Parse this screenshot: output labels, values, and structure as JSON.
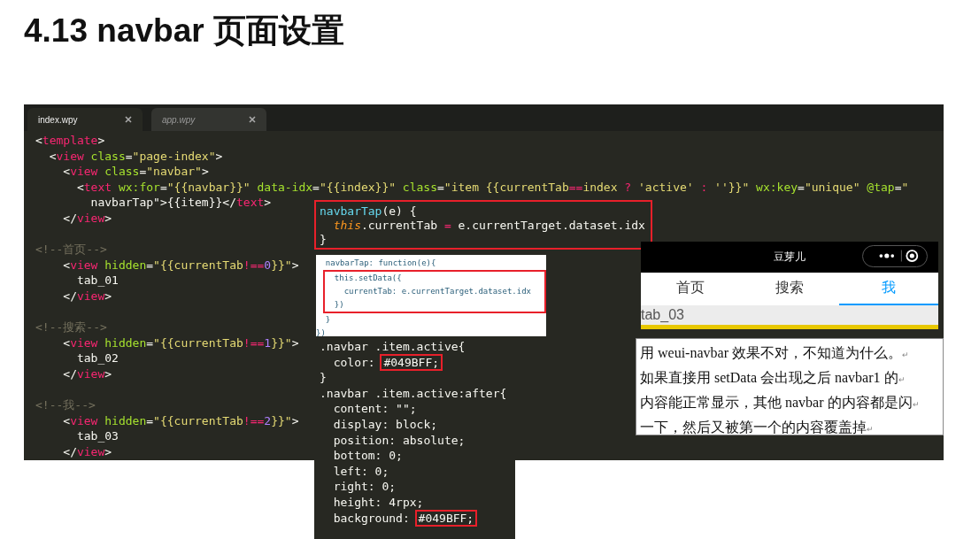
{
  "title": "4.13 navbar 页面设置",
  "editor": {
    "tabs": [
      {
        "label": "index.wpy",
        "selected": true
      },
      {
        "label": "app.wpy",
        "selected": false
      }
    ],
    "blocks": [
      {
        "lines": [
          [
            {
              "text": "<",
              "kind": "p"
            },
            {
              "text": "template",
              "kind": "tag"
            },
            {
              "text": ">",
              "kind": "p"
            }
          ],
          [
            {
              "text": "  <",
              "kind": "p"
            },
            {
              "text": "view",
              "kind": "tag"
            },
            {
              "text": " class",
              "kind": "attr"
            },
            {
              "text": "=",
              "kind": "p"
            },
            {
              "text": "\"page-index\"",
              "kind": "str"
            },
            {
              "text": ">",
              "kind": "p"
            }
          ],
          [
            {
              "text": "    <",
              "kind": "p"
            },
            {
              "text": "view",
              "kind": "tag"
            },
            {
              "text": " class",
              "kind": "attr"
            },
            {
              "text": "=",
              "kind": "p"
            },
            {
              "text": "\"navbar\"",
              "kind": "str"
            },
            {
              "text": ">",
              "kind": "p"
            }
          ],
          [
            {
              "text": "      <",
              "kind": "p"
            },
            {
              "text": "text",
              "kind": "tag"
            },
            {
              "text": " wx:for",
              "kind": "attr"
            },
            {
              "text": "=",
              "kind": "p"
            },
            {
              "text": "\"{{navbar}}\"",
              "kind": "str"
            },
            {
              "text": " data-idx",
              "kind": "attr"
            },
            {
              "text": "=",
              "kind": "p"
            },
            {
              "text": "\"{{index}}\"",
              "kind": "str"
            },
            {
              "text": " class",
              "kind": "attr"
            },
            {
              "text": "=",
              "kind": "p"
            },
            {
              "text": "\"item {{currentTab",
              "kind": "str"
            },
            {
              "text": "==",
              "kind": "op"
            },
            {
              "text": "index ",
              "kind": "str"
            },
            {
              "text": "?",
              "kind": "op"
            },
            {
              "text": " 'active' ",
              "kind": "str"
            },
            {
              "text": ":",
              "kind": "op"
            },
            {
              "text": " ''}}\"",
              "kind": "str"
            },
            {
              "text": " wx:key",
              "kind": "attr"
            },
            {
              "text": "=",
              "kind": "p"
            },
            {
              "text": "\"unique\"",
              "kind": "str"
            },
            {
              "text": " @tap",
              "kind": "attr"
            },
            {
              "text": "=",
              "kind": "p"
            },
            {
              "text": "\"",
              "kind": "str"
            }
          ],
          [
            {
              "text": "        navbarTap\">{{item}}</",
              "kind": "p"
            },
            {
              "text": "text",
              "kind": "tag"
            },
            {
              "text": ">",
              "kind": "p"
            }
          ],
          [
            {
              "text": "    </",
              "kind": "p"
            },
            {
              "text": "view",
              "kind": "tag"
            },
            {
              "text": ">",
              "kind": "p"
            }
          ]
        ]
      },
      {
        "lines": [
          [
            {
              "text": "<!--首页-->",
              "kind": "cm"
            }
          ],
          [
            {
              "text": "    <",
              "kind": "p"
            },
            {
              "text": "view",
              "kind": "tag"
            },
            {
              "text": " hidden",
              "kind": "attr"
            },
            {
              "text": "=",
              "kind": "p"
            },
            {
              "text": "\"{{currentTab",
              "kind": "str"
            },
            {
              "text": "!==",
              "kind": "op"
            },
            {
              "text": "0",
              "kind": "num"
            },
            {
              "text": "}}\"",
              "kind": "str"
            },
            {
              "text": ">",
              "kind": "p"
            }
          ],
          [
            {
              "text": "      tab_01",
              "kind": "p"
            }
          ],
          [
            {
              "text": "    </",
              "kind": "p"
            },
            {
              "text": "view",
              "kind": "tag"
            },
            {
              "text": ">",
              "kind": "p"
            }
          ]
        ]
      },
      {
        "lines": [
          [
            {
              "text": "<!--搜索-->",
              "kind": "cm"
            }
          ],
          [
            {
              "text": "    <",
              "kind": "p"
            },
            {
              "text": "view",
              "kind": "tag"
            },
            {
              "text": " hidden",
              "kind": "attr"
            },
            {
              "text": "=",
              "kind": "p"
            },
            {
              "text": "\"{{currentTab",
              "kind": "str"
            },
            {
              "text": "!==",
              "kind": "op"
            },
            {
              "text": "1",
              "kind": "num"
            },
            {
              "text": "}}\"",
              "kind": "str"
            },
            {
              "text": ">",
              "kind": "p"
            }
          ],
          [
            {
              "text": "      tab_02",
              "kind": "p"
            }
          ],
          [
            {
              "text": "    </",
              "kind": "p"
            },
            {
              "text": "view",
              "kind": "tag"
            },
            {
              "text": ">",
              "kind": "p"
            }
          ]
        ]
      },
      {
        "lines": [
          [
            {
              "text": "<!--我-->",
              "kind": "cm"
            }
          ],
          [
            {
              "text": "    <",
              "kind": "p"
            },
            {
              "text": "view",
              "kind": "tag"
            },
            {
              "text": " hidden",
              "kind": "attr"
            },
            {
              "text": "=",
              "kind": "p"
            },
            {
              "text": "\"{{currentTab",
              "kind": "str"
            },
            {
              "text": "!==",
              "kind": "op"
            },
            {
              "text": "2",
              "kind": "num"
            },
            {
              "text": "}}\"",
              "kind": "str"
            },
            {
              "text": ">",
              "kind": "p"
            }
          ],
          [
            {
              "text": "      tab_03",
              "kind": "p"
            }
          ],
          [
            {
              "text": "    </",
              "kind": "p"
            },
            {
              "text": "view",
              "kind": "tag"
            },
            {
              "text": ">",
              "kind": "p"
            }
          ]
        ]
      }
    ]
  },
  "handler_box": {
    "lines": [
      [
        {
          "text": "navbarTap",
          "kind": "fn"
        },
        {
          "text": "(e) {",
          "kind": "p"
        }
      ],
      [
        {
          "text": "  this",
          "kind": "kw"
        },
        {
          "text": ".currentTab ",
          "kind": "p"
        },
        {
          "text": "=",
          "kind": "op"
        },
        {
          "text": " e.currentTarget.dataset.idx",
          "kind": "p"
        }
      ],
      [
        {
          "text": "}",
          "kind": "p"
        }
      ]
    ]
  },
  "snippet": {
    "before": [
      "  navbarTap: function(e){"
    ],
    "highlighted": [
      "    this.setData({",
      "      currentTab: e.currentTarget.dataset.idx",
      "    })"
    ],
    "after": [
      "  }",
      "})"
    ]
  },
  "css": {
    "lines": [
      {
        "text": ".navbar .item.active{"
      },
      {
        "text": "  color: ",
        "highlight": "#049BFF;"
      },
      {
        "text": "}"
      },
      {
        "text": ".navbar .item.active:after{"
      },
      {
        "text": "  content: \"\";"
      },
      {
        "text": "  display: block;"
      },
      {
        "text": "  position: absolute;"
      },
      {
        "text": "  bottom: 0;"
      },
      {
        "text": "  left: 0;"
      },
      {
        "text": "  right: 0;"
      },
      {
        "text": "  height: 4rpx;"
      },
      {
        "text": "  background: ",
        "highlight": "#049BFF;"
      }
    ]
  },
  "phone": {
    "title": "豆芽儿",
    "tabs": [
      {
        "label": "首页",
        "selected": false
      },
      {
        "label": "搜索",
        "selected": false
      },
      {
        "label": "我",
        "selected": true
      }
    ],
    "content": "tab_03"
  },
  "note": {
    "lines": [
      {
        "text": "用 weui-navbar 效果不对，不知道为什么。",
        "mark": "↵"
      },
      {
        "text": "如果直接用 setData 会出现之后 navbar1 的",
        "mark": "↵"
      },
      {
        "text": "内容能正常显示，其他 navbar 的内容都是闪",
        "mark": "↵"
      },
      {
        "text": "一下，然后又被第一个的内容覆盖掉",
        "mark": "↵"
      }
    ]
  }
}
